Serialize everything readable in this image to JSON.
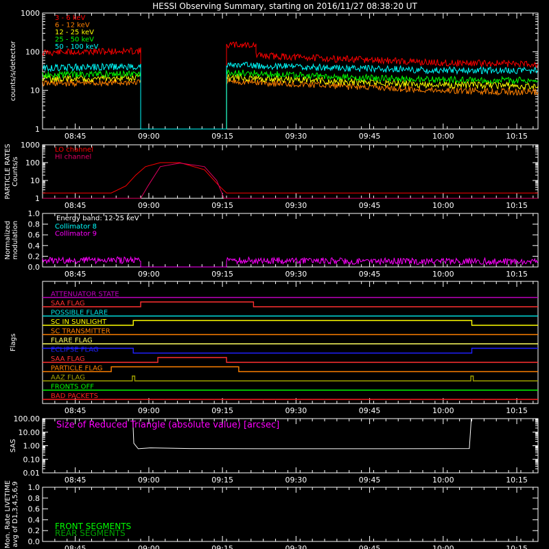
{
  "title": "HESSI Observing Summary, starting on 2016/11/27 08:38:20 UT",
  "time_ticks": [
    "08:45",
    "09:00",
    "09:15",
    "09:30",
    "09:45",
    "10:00",
    "10:15"
  ],
  "time_tick_minutes": [
    6.67,
    21.67,
    36.67,
    51.67,
    66.67,
    81.67,
    96.67
  ],
  "time_range_minutes": [
    0,
    101
  ],
  "chart_data": [
    {
      "type": "line",
      "panel": "count-rates",
      "ylabel": "counts/s/detector",
      "yscale": "log",
      "ylim": [
        1,
        1000
      ],
      "y_ticks": [
        "1",
        "10",
        "100",
        "1000"
      ],
      "y_tick_values": [
        1,
        10,
        100,
        1000
      ],
      "x_unit": "minutes since start",
      "series": [
        {
          "name": "3 - 6 keV",
          "color": "#ff0000",
          "x": [
            0,
            20,
            20.01,
            37.5,
            37.51,
            43.5,
            43.51,
            60,
            80,
            101
          ],
          "y": [
            95,
            105,
            1,
            1,
            150,
            150,
            80,
            65,
            52,
            48
          ]
        },
        {
          "name": "6 - 12 keV",
          "color": "#ff8000",
          "x": [
            0,
            20,
            20.01,
            37.5,
            37.51,
            60,
            80,
            101
          ],
          "y": [
            15,
            16,
            1,
            1,
            17,
            13,
            10,
            9
          ]
        },
        {
          "name": "12 - 25 keV",
          "color": "#ffff00",
          "x": [
            0,
            20,
            20.01,
            37.5,
            37.51,
            60,
            80,
            101
          ],
          "y": [
            20,
            21,
            1,
            1,
            22,
            17,
            14,
            13
          ]
        },
        {
          "name": "25 - 50 keV",
          "color": "#00ff00",
          "x": [
            0,
            20,
            20.01,
            37.5,
            37.51,
            60,
            80,
            101
          ],
          "y": [
            25,
            27,
            1,
            1,
            29,
            22,
            19,
            18
          ]
        },
        {
          "name": "50 - 100 keV",
          "color": "#00ffff",
          "x": [
            0,
            20,
            20.01,
            37.5,
            37.51,
            60,
            80,
            101
          ],
          "y": [
            38,
            42,
            1,
            1,
            45,
            38,
            33,
            32
          ]
        }
      ]
    },
    {
      "type": "line",
      "panel": "particle-rates",
      "ylabel": "PARTICLE RATES\nCounts/s",
      "yscale": "log",
      "ylim": [
        1,
        1000
      ],
      "y_ticks": [
        "1",
        "10",
        "100",
        "1000"
      ],
      "y_tick_values": [
        1,
        10,
        100,
        1000
      ],
      "x_unit": "minutes since start",
      "series": [
        {
          "name": "LO channel",
          "color": "#ff0000",
          "x": [
            0,
            14,
            17,
            19,
            21,
            24,
            28,
            33,
            36,
            37.5,
            101
          ],
          "y": [
            2,
            2,
            5,
            20,
            60,
            100,
            100,
            40,
            5,
            2,
            2
          ]
        },
        {
          "name": "HI channel",
          "color": "#e00060",
          "x": [
            0,
            20,
            21.5,
            24,
            28,
            33,
            35.5,
            37,
            101
          ],
          "y": [
            1,
            1,
            5,
            60,
            95,
            60,
            10,
            1,
            1
          ]
        }
      ]
    },
    {
      "type": "line",
      "panel": "modulation",
      "ylabel": "Normalized\nmodulation",
      "ylim": [
        0,
        1
      ],
      "y_ticks": [
        "0.0",
        "0.2",
        "0.4",
        "0.6",
        "0.8",
        "1.0"
      ],
      "y_tick_values": [
        0,
        0.2,
        0.4,
        0.6,
        0.8,
        1.0
      ],
      "annotation": "Energy band: 12-25 keV",
      "x_unit": "minutes since start",
      "series": [
        {
          "name": "Collimator 8",
          "color": "#00ffff",
          "x": [],
          "y": []
        },
        {
          "name": "Collimator 9",
          "color": "#ff00ff",
          "x": [
            0,
            20,
            20.01,
            37.5,
            37.51,
            101
          ],
          "y": [
            0.12,
            0.13,
            0,
            0,
            0.12,
            0.1
          ]
        }
      ]
    },
    {
      "type": "line",
      "panel": "flags",
      "ylabel": "Flags",
      "x_unit": "minutes since start",
      "series": [
        {
          "name": "ATTENUATOR STATE",
          "color": "#c000c0",
          "x": [
            0,
            101
          ],
          "y": [
            0,
            0
          ]
        },
        {
          "name": "SAA FLAG",
          "color": "#ff3030",
          "x": [
            0,
            20,
            20,
            43,
            43,
            101
          ],
          "y": [
            0,
            0,
            1,
            1,
            0,
            0
          ]
        },
        {
          "name": "POSSIBLE FLARE",
          "color": "#00e0e0",
          "x": [
            0,
            101
          ],
          "y": [
            0,
            0
          ]
        },
        {
          "name": "SC IN SUNLIGHT",
          "color": "#ffff00",
          "x": [
            0,
            18.5,
            18.5,
            87.5,
            87.5,
            101
          ],
          "y": [
            0,
            0,
            1,
            1,
            0,
            0
          ]
        },
        {
          "name": "SC TRANSMITTER",
          "color": "#ff8000",
          "x": [
            0,
            101
          ],
          "y": [
            0,
            0
          ]
        },
        {
          "name": "FLARE FLAG",
          "color": "#ffff60",
          "x": [
            0,
            101
          ],
          "y": [
            0,
            0
          ]
        },
        {
          "name": "ECLIPSE FLAG",
          "color": "#2020ff",
          "x": [
            0,
            18.5,
            18.5,
            87.5,
            87.5,
            101
          ],
          "y": [
            1,
            1,
            0,
            0,
            1,
            1
          ]
        },
        {
          "name": "SAA FLAG",
          "color": "#ff3030",
          "x": [
            0,
            23.5,
            23.5,
            37.5,
            37.5,
            101
          ],
          "y": [
            0,
            0,
            1,
            1,
            0,
            0
          ]
        },
        {
          "name": "PARTICLE FLAG",
          "color": "#ff8000",
          "x": [
            0,
            14,
            14,
            40,
            40,
            101
          ],
          "y": [
            0,
            0,
            1,
            1,
            0,
            0
          ]
        },
        {
          "name": "AAZ FLAG",
          "color": "#a0a000",
          "x": [
            0,
            18.3,
            18.3,
            18.8,
            18.8,
            87.3,
            87.3,
            87.8,
            87.8,
            101
          ],
          "y": [
            0,
            0,
            1,
            1,
            0,
            0,
            1,
            1,
            0,
            0
          ]
        },
        {
          "name": "FRONTS OFF",
          "color": "#00ff00",
          "x": [
            0,
            101
          ],
          "y": [
            0,
            0
          ]
        },
        {
          "name": "BAD PACKETS",
          "color": "#ff2020",
          "x": [
            0,
            101
          ],
          "y": [
            0,
            0
          ]
        }
      ]
    },
    {
      "type": "line",
      "panel": "sas",
      "ylabel": "SAS",
      "yscale": "log",
      "ylim": [
        0.01,
        100
      ],
      "y_ticks": [
        "0.01",
        "0.10",
        "1.00",
        "10.00",
        "100.00"
      ],
      "y_tick_values": [
        0.01,
        0.1,
        1,
        10,
        100
      ],
      "annotation": "Size of Reduced Triangle (absolute value) [arcsec]",
      "x_unit": "minutes since start",
      "series": [
        {
          "name": "",
          "color": "#ffffff",
          "x": [
            18.4,
            18.6,
            19.5,
            22,
            30,
            50,
            70,
            87,
            87.4
          ],
          "y": [
            100,
            1.5,
            0.6,
            0.7,
            0.62,
            0.6,
            0.6,
            0.62,
            100
          ]
        }
      ]
    },
    {
      "type": "line",
      "panel": "livetime",
      "ylabel": "Mon. Rate LIVETIME\navg of D1,3,4,5,6,9",
      "ylim": [
        0,
        1
      ],
      "y_ticks": [
        "0.0",
        "0.2",
        "0.4",
        "0.6",
        "0.8",
        "1.0"
      ],
      "y_tick_values": [
        0,
        0.2,
        0.4,
        0.6,
        0.8,
        1.0
      ],
      "x_unit": "minutes since start",
      "series": [
        {
          "name": "FRONT SEGMENTS",
          "color": "#00ff00",
          "x": [],
          "y": []
        },
        {
          "name": "REAR SEGMENTS",
          "color": "#00a000",
          "x": [],
          "y": []
        }
      ]
    }
  ]
}
